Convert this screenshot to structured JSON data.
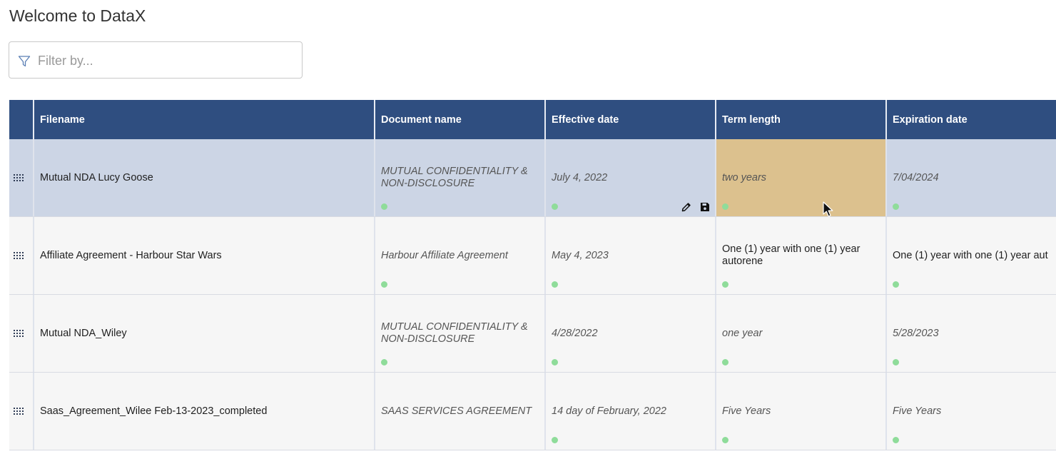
{
  "app": {
    "title": "Welcome to DataX"
  },
  "filter": {
    "placeholder": "Filter by...",
    "value": ""
  },
  "table": {
    "columns": [
      "Filename",
      "Document name",
      "Effective date",
      "Term length",
      "Expiration date"
    ],
    "rows": [
      {
        "filename": "Mutual NDA Lucy Goose",
        "document_name": "MUTUAL CONFIDENTIALITY & NON-DISCLOSURE",
        "effective_date": "July 4, 2022",
        "term_length": "two years",
        "expiration_date": "7/04/2024"
      },
      {
        "filename": "Affiliate Agreement - Harbour Star Wars",
        "document_name": "Harbour Affiliate Agreement",
        "effective_date": "May 4, 2023",
        "term_length": "One (1) year with one (1) year autorene",
        "expiration_date": "One (1) year with one (1) year aut"
      },
      {
        "filename": "Mutual NDA_Wiley",
        "document_name": "MUTUAL CONFIDENTIALITY & NON-DISCLOSURE",
        "effective_date": "4/28/2022",
        "term_length": "one year",
        "expiration_date": "5/28/2023"
      },
      {
        "filename": "Saas_Agreement_Wilee Feb-13-2023_completed",
        "document_name": "SAAS SERVICES AGREEMENT",
        "effective_date": "14 day of February, 2022",
        "term_length": "Five Years",
        "expiration_date": "Five Years"
      }
    ]
  },
  "colors": {
    "header_bg": "#2f4e80",
    "selected_row_bg": "#ccd5e5",
    "editing_cell_bg": "#dcc18e",
    "status_dot": "#8fdc9a"
  },
  "icons": [
    "filter-icon",
    "drag-handle-icon",
    "pencil-icon",
    "save-icon",
    "mouse-cursor-icon"
  ]
}
